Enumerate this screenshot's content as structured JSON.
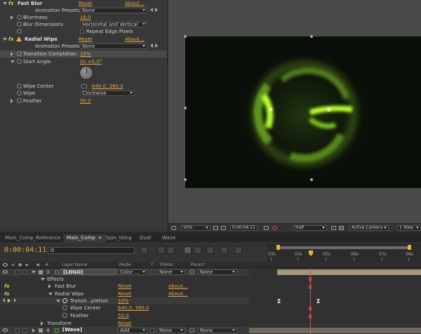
{
  "effect_controls": {
    "fast_blur": {
      "name": "Fast Blur",
      "reset": "Reset",
      "about": "About...",
      "animation_presets_label": "Animation Presets:",
      "animation_presets_value": "None",
      "blurriness_label": "Blurriness",
      "blurriness_value": "18,0",
      "blur_dimensions_label": "Blur Dimensions",
      "blur_dimensions_value": "Horizontal and Vertical",
      "repeat_edge_label": "Repeat Edge Pixels"
    },
    "radial_wipe": {
      "name": "Radial Wipe",
      "reset": "Reset",
      "about": "About...",
      "animation_presets_label": "Animation Presets:",
      "animation_presets_value": "None",
      "transition_completion_label": "Transition Completion",
      "transition_completion_value": "10%",
      "start_angle_label": "Start Angle",
      "start_angle_value": "0x +0,0°",
      "wipe_center_label": "Wipe Center",
      "wipe_center_value": "640,0, 360,0",
      "wipe_label": "Wipe",
      "wipe_value": "Clockwise",
      "feather_label": "Feather",
      "feather_value": "50,0"
    }
  },
  "viewer": {
    "zoom": "50%",
    "timecode": "0:00:04:11",
    "resolution": "Half",
    "camera": "Active Camera",
    "view": "1 View"
  },
  "timeline": {
    "tabs": [
      {
        "label": "Main_Comp_Reference"
      },
      {
        "label": "Main_Comp",
        "close": "×"
      },
      {
        "label": "Spin_thing"
      },
      {
        "label": "Dust"
      },
      {
        "label": "Wave"
      }
    ],
    "timecode": "0:00:04:11",
    "columns": {
      "layer_name": "Layer Name",
      "mode": "Mode",
      "t": "T",
      "trkmat": "TrkMat",
      "parent": "Parent"
    },
    "ruler_labels": [
      "03s",
      "04s",
      "05s",
      "06s",
      "07s",
      "08s"
    ],
    "layer3": {
      "number": "3",
      "name": "[LOGO]",
      "mode": "Color ...",
      "trkmat": "None",
      "parent": "None"
    },
    "effects_label": "Effects",
    "fast_blur_label": "Fast Blur",
    "fast_blur_reset": "Reset",
    "fast_blur_about": "About...",
    "radial_wipe_label": "Radial Wipe",
    "radial_wipe_reset": "Reset",
    "radial_wipe_about": "About...",
    "transition_label": "Transit...pletion",
    "transition_value": "10%",
    "wipe_center_label": "Wipe Center",
    "wipe_center_value": "640,0, 360,0",
    "feather_label": "Feather",
    "feather_value": "50,0",
    "transform_label": "Transform",
    "transform_reset": "Reset",
    "layer4": {
      "number": "4",
      "name": "[Wave]",
      "mode": "Add",
      "trkmat": "None",
      "parent": "None"
    }
  },
  "colors": {
    "accent": "#e7a445",
    "timecode": "#e8b23a",
    "cti": "#e04a4a",
    "label_tan": "#a5987a"
  }
}
